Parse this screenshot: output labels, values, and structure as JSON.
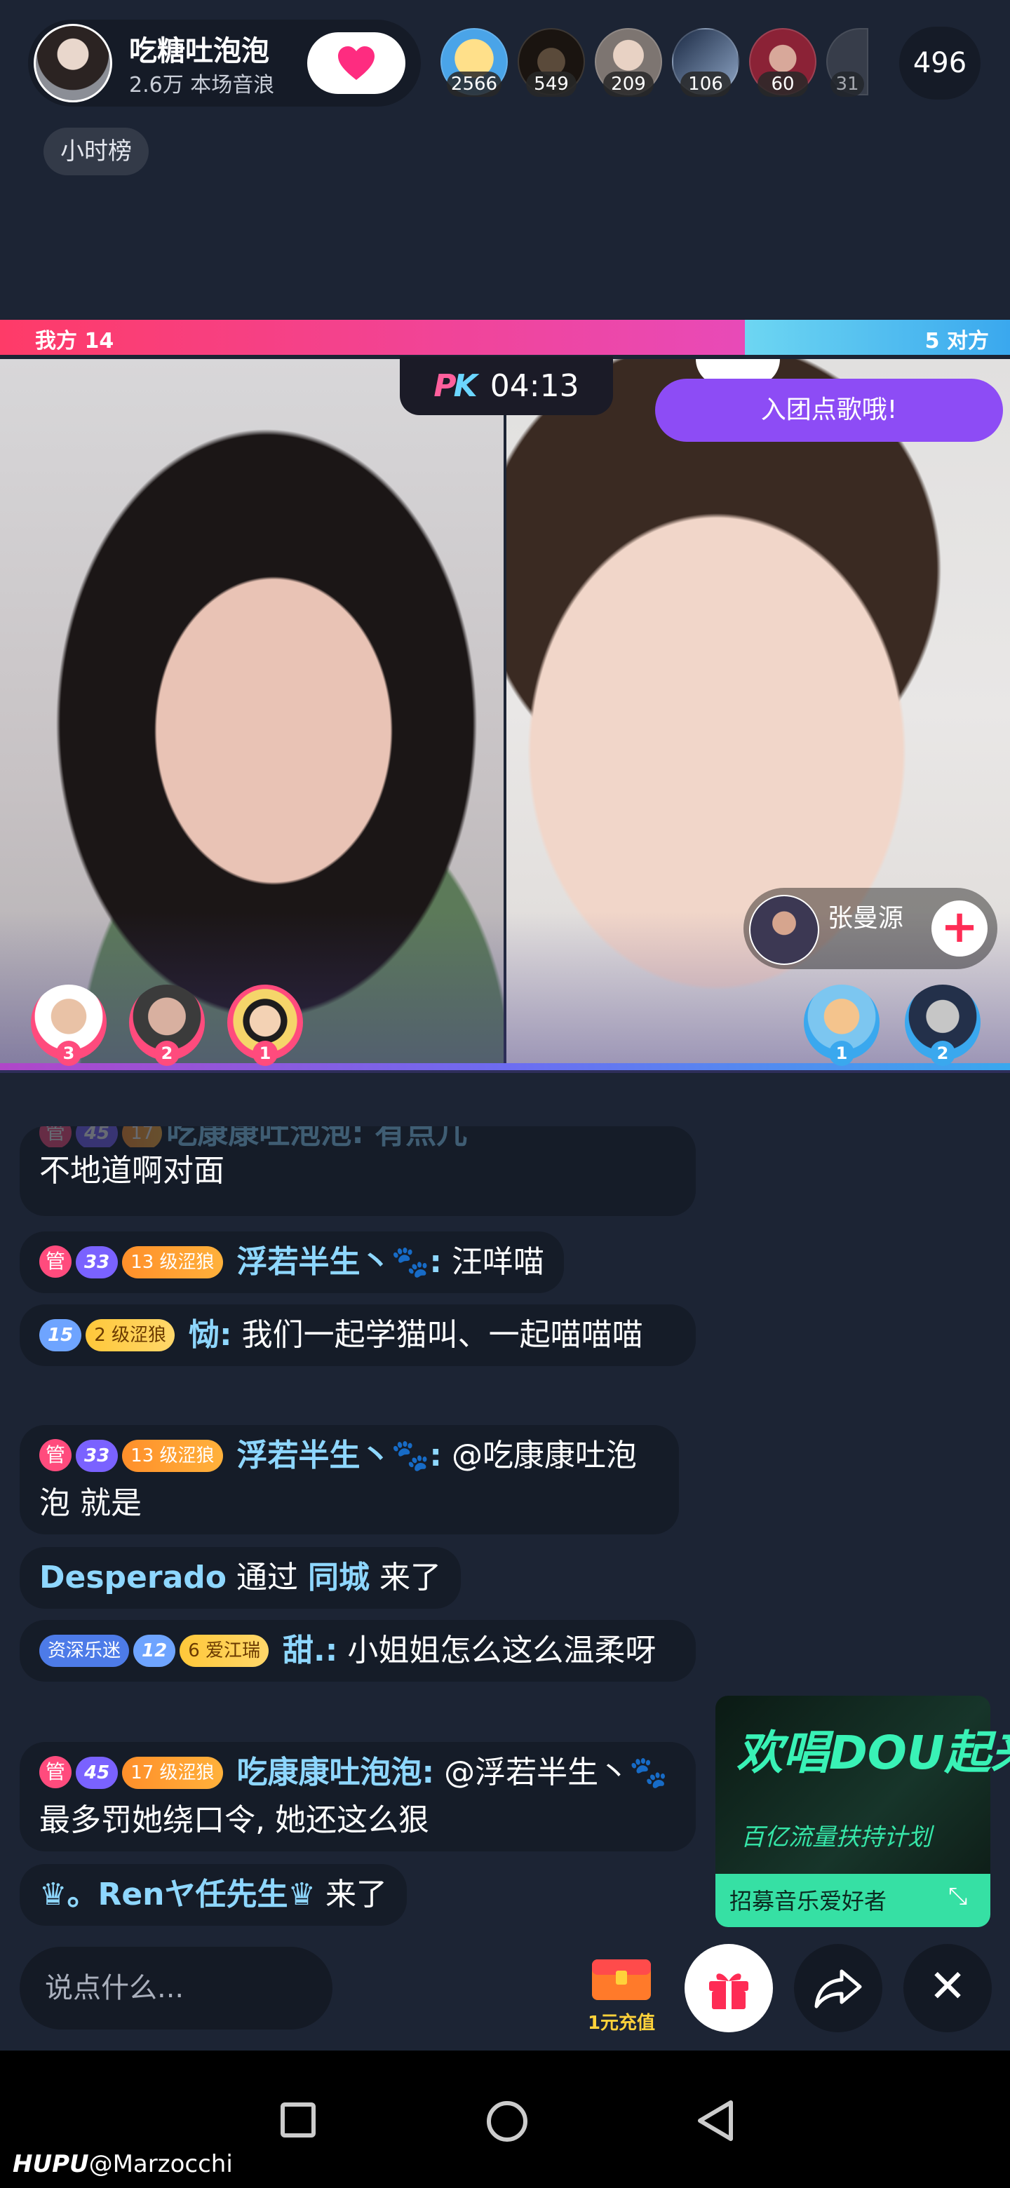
{
  "header": {
    "host_name": "吃糖吐泡泡",
    "host_sub": "2.6万 本场音浪",
    "viewers": [
      {
        "count": "2566",
        "color": "#f2c65a"
      },
      {
        "count": "549",
        "color": "#3b3026"
      },
      {
        "count": "209",
        "color": "#9a8e84"
      },
      {
        "count": "106",
        "color": "#3c4d6a"
      },
      {
        "count": "60",
        "color": "#7a2f3c"
      },
      {
        "count": "31",
        "color": "#4a4f5a"
      }
    ],
    "viewer_total": "496",
    "hourly_rank": "小时榜"
  },
  "pk": {
    "our_label": "我方 14",
    "their_label": "5 对方",
    "our_score": 14,
    "their_score": 5,
    "logo_p": "P",
    "logo_k": "K",
    "timer": "04:13",
    "join_banner": "入团点歌哦!",
    "rival_name": "张曼源",
    "left_supporters": [
      {
        "rank": "3",
        "color": "#ff4b7d"
      },
      {
        "rank": "2",
        "color": "#ff4b7d"
      },
      {
        "rank": "1",
        "color": "#ff4b7d"
      }
    ],
    "right_supporters": [
      {
        "rank": "1",
        "color": "#3aa8ee"
      },
      {
        "rank": "2",
        "color": "#3aa8ee"
      }
    ]
  },
  "chat": {
    "partial_top": "不地道啊对面",
    "partial_name": "吃康康吐泡泡: 有点儿",
    "messages": [
      {
        "admin": "管",
        "gem": "33",
        "level": "13 级涩狼",
        "user": "浮若半生丶🐾:",
        "text": "汪咩喵"
      },
      {
        "gem": "15",
        "level": "2 级涩狼",
        "user": "恸:",
        "text": "我们一起学猫叫、一起喵喵喵"
      },
      {
        "admin": "管",
        "gem": "33",
        "level": "13 级涩狼",
        "user": "浮若半生丶🐾:",
        "text": "@吃康康吐泡泡 就是"
      },
      {
        "user": "Desperado",
        "text_a": "通过",
        "text_b": "同城",
        "text_c": "来了"
      },
      {
        "vet": "资深乐迷",
        "gem": "12",
        "level": "6 爱江瑞",
        "user": "甜.:",
        "text": "小姐姐怎么这么温柔呀"
      },
      {
        "admin": "管",
        "gem": "45",
        "level": "17 级涩狼",
        "user": "吃康康吐泡泡:",
        "text": "@浮若半生丶🐾 最多罚她绕口令, 她还这么狠"
      },
      {
        "user": "♛。Renヤ任先生♛",
        "text": "来了"
      }
    ]
  },
  "promo": {
    "title": "欢唱DOU起来",
    "subtitle": "百亿流量扶持计划",
    "bar": "招募音乐爱好者"
  },
  "bottom": {
    "input_placeholder": "说点什么...",
    "recharge": "1元充值"
  },
  "watermark": {
    "brand": "HUPU",
    "handle": "@Marzocchi"
  }
}
